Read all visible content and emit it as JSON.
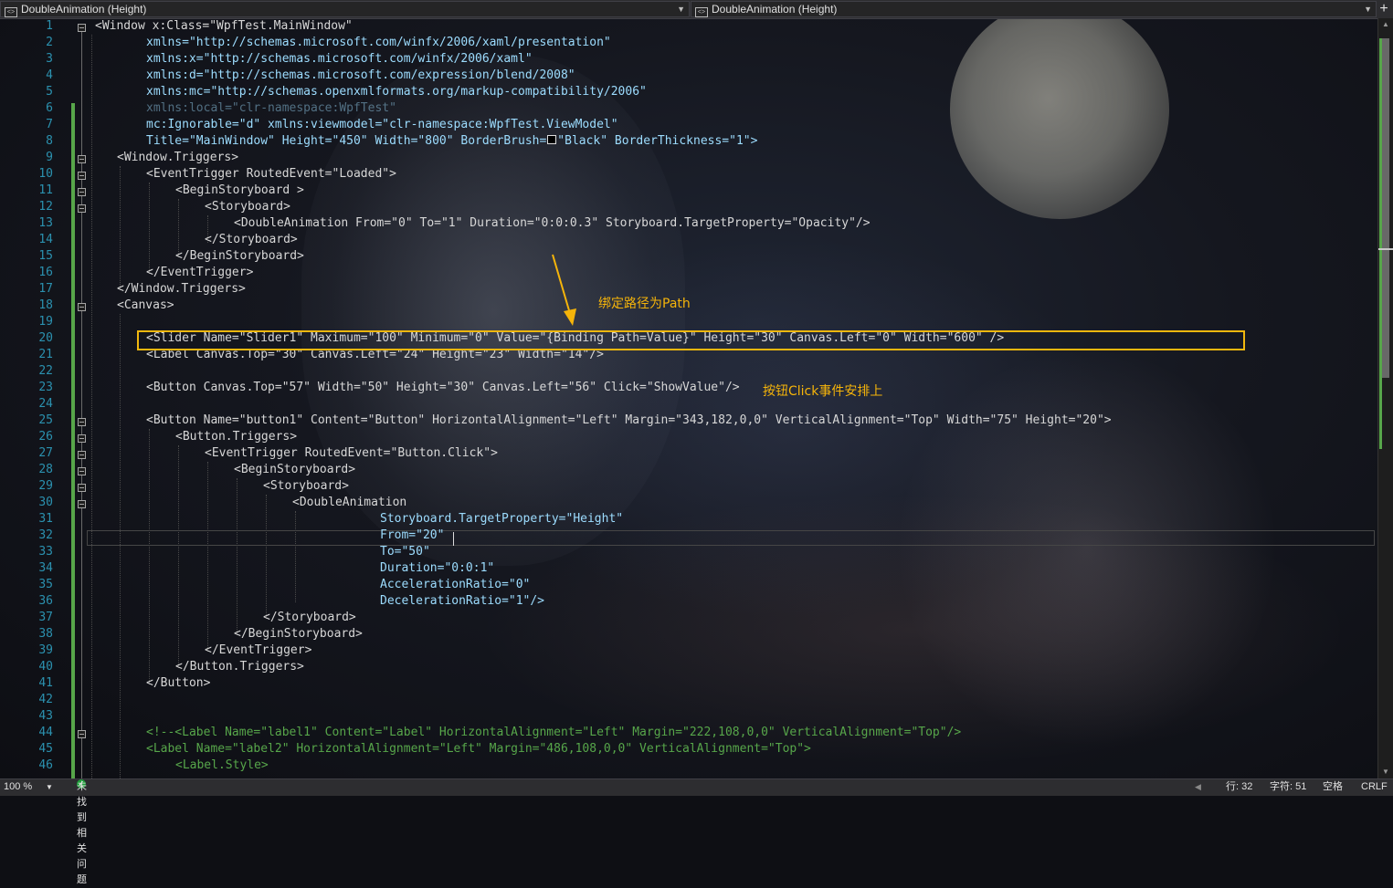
{
  "header": {
    "left_dropdown": "DoubleAnimation (Height)",
    "right_dropdown": "DoubleAnimation (Height)",
    "add_icon": "+"
  },
  "editor": {
    "line_numbers": [
      "1",
      "2",
      "3",
      "4",
      "5",
      "6",
      "7",
      "8",
      "9",
      "10",
      "11",
      "12",
      "13",
      "14",
      "15",
      "16",
      "17",
      "18",
      "19",
      "20",
      "21",
      "22",
      "23",
      "24",
      "25",
      "26",
      "27",
      "28",
      "29",
      "30",
      "31",
      "32",
      "33",
      "34",
      "35",
      "36",
      "37",
      "38",
      "39",
      "40",
      "41",
      "42",
      "43",
      "44",
      "45",
      "46"
    ],
    "lines": {
      "l1": "<Window x:Class=\"WpfTest.MainWindow\"",
      "l2": "xmlns=\"http://schemas.microsoft.com/winfx/2006/xaml/presentation\"",
      "l3": "xmlns:x=\"http://schemas.microsoft.com/winfx/2006/xaml\"",
      "l4": "xmlns:d=\"http://schemas.microsoft.com/expression/blend/2008\"",
      "l5": "xmlns:mc=\"http://schemas.openxmlformats.org/markup-compatibility/2006\"",
      "l6": "xmlns:local=\"clr-namespace:WpfTest\"",
      "l7": "mc:Ignorable=\"d\" xmlns:viewmodel=\"clr-namespace:WpfTest.ViewModel\"",
      "l8a": "Title=\"MainWindow\" Height=\"450\" Width=\"800\" BorderBrush=",
      "l8b": "\"Black\" BorderThickness=\"1\">",
      "l9": "<Window.Triggers>",
      "l10": "<EventTrigger RoutedEvent=\"Loaded\">",
      "l11": "<BeginStoryboard >",
      "l12": "<Storyboard>",
      "l13": "<DoubleAnimation From=\"0\" To=\"1\" Duration=\"0:0:0.3\" Storyboard.TargetProperty=\"Opacity\"/>",
      "l14": "</Storyboard>",
      "l15": "</BeginStoryboard>",
      "l16": "</EventTrigger>",
      "l17": "</Window.Triggers>",
      "l18": "<Canvas>",
      "l19": "",
      "l20": "<Slider Name=\"Slider1\" Maximum=\"100\" Minimum=\"0\" Value=\"{Binding Path=Value}\" Height=\"30\" Canvas.Left=\"0\" Width=\"600\" />",
      "l21": "<Label Canvas.Top=\"30\" Canvas.Left=\"24\" Height=\"23\" Width=\"14\"/>",
      "l22": "",
      "l23": "<Button Canvas.Top=\"57\" Width=\"50\" Height=\"30\" Canvas.Left=\"56\" Click=\"ShowValue\"/>",
      "l24": "",
      "l25": "<Button Name=\"button1\" Content=\"Button\" HorizontalAlignment=\"Left\" Margin=\"343,182,0,0\" VerticalAlignment=\"Top\" Width=\"75\" Height=\"20\">",
      "l26": "<Button.Triggers>",
      "l27": "<EventTrigger RoutedEvent=\"Button.Click\">",
      "l28": "<BeginStoryboard>",
      "l29": "<Storyboard>",
      "l30": "<DoubleAnimation",
      "l31": "Storyboard.TargetProperty=\"Height\"",
      "l32": "From=\"20\"",
      "l33": "To=\"50\"",
      "l34": "Duration=\"0:0:1\"",
      "l35": "AccelerationRatio=\"0\"",
      "l36": "DecelerationRatio=\"1\"/>",
      "l37": "</Storyboard>",
      "l38": "</BeginStoryboard>",
      "l39": "</EventTrigger>",
      "l40": "</Button.Triggers>",
      "l41": "</Button>",
      "l42": "",
      "l43": "",
      "l44": "<!--<Label Name=\"label1\" Content=\"Label\" HorizontalAlignment=\"Left\" Margin=\"222,108,0,0\" VerticalAlignment=\"Top\"/>",
      "l45": "<Label Name=\"label2\" HorizontalAlignment=\"Left\" Margin=\"486,108,0,0\" VerticalAlignment=\"Top\">",
      "l46": "<Label.Style>"
    }
  },
  "annotations": {
    "binding_note": "绑定路径为Path",
    "click_note": "按钮Click事件安排上"
  },
  "status": {
    "zoom": "100 %",
    "issues": "未找到相关问题",
    "line": "行: 32",
    "char": "字符: 51",
    "whitespace": "空格",
    "line_ending": "CRLF"
  },
  "colors": {
    "highlight_box": "#f0b70e",
    "annotation_text": "#f5b40a",
    "change_bar": "#57a64a",
    "line_number": "#2b91af"
  }
}
